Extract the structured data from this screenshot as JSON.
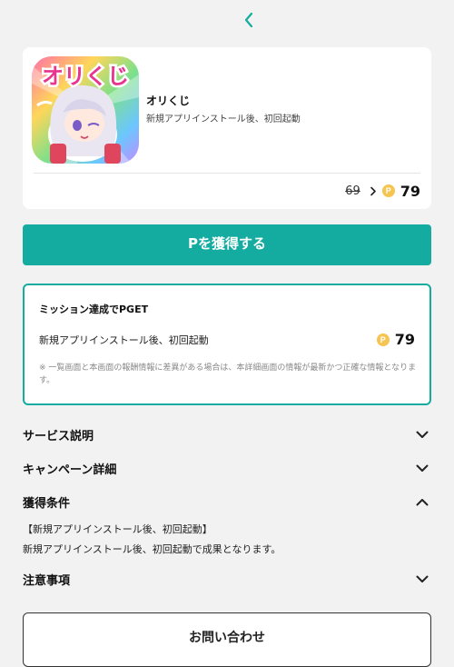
{
  "header": {
    "back_icon": "chevron-left-icon"
  },
  "app": {
    "name": "オリくじ",
    "description": "新規アプリインストール後、初回起動",
    "icon_title": "オリくじ",
    "old_points": "69",
    "new_points": "79",
    "coin_label": "P"
  },
  "get_button": {
    "label": "Pを獲得する"
  },
  "mission": {
    "title": "ミッション達成でPGET",
    "row_label": "新規アプリインストール後、初回起動",
    "points": "79",
    "coin_label": "P",
    "note": "※ 一覧画面と本画面の報酬情報に差異がある場合は、本詳細画面の情報が最新かつ正確な情報となります。"
  },
  "sections": {
    "service": {
      "title": "サービス説明",
      "state": "collapsed"
    },
    "campaign": {
      "title": "キャンペーン詳細",
      "state": "collapsed"
    },
    "conditions": {
      "title": "獲得条件",
      "state": "expanded",
      "line1": "【新規アプリインストール後、初回起動】",
      "line2": "新規アプリインストール後、初回起動で成果となります。"
    },
    "notes": {
      "title": "注意事項",
      "state": "collapsed"
    }
  },
  "contact_button": {
    "label": "お問い合わせ"
  },
  "colors": {
    "accent": "#14aca0",
    "background": "#f2f2f2",
    "coin": "#f5c451"
  }
}
